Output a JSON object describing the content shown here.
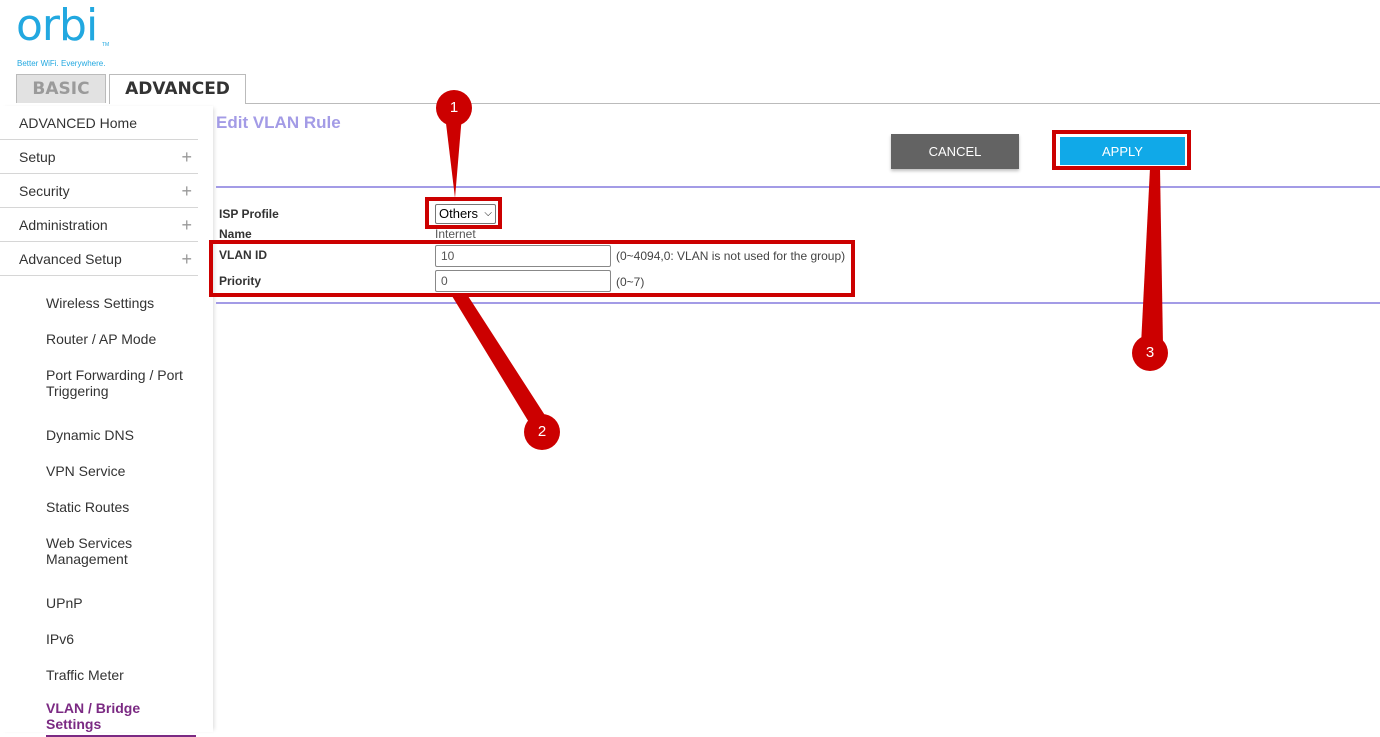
{
  "brand": {
    "logo": "orbi",
    "tm": "TM",
    "tagline": "Better WiFi. Everywhere."
  },
  "tabs": [
    {
      "label": "BASIC"
    },
    {
      "label": "ADVANCED"
    }
  ],
  "sidebar": {
    "top_items": [
      {
        "label": "ADVANCED Home"
      },
      {
        "label": "Setup",
        "icon": "plus-icon",
        "expand": "+"
      },
      {
        "label": "Security",
        "icon": "plus-icon",
        "expand": "+"
      },
      {
        "label": "Administration",
        "icon": "plus-icon",
        "expand": "+"
      },
      {
        "label": "Advanced Setup",
        "icon": "plus-icon",
        "expand": "+"
      }
    ],
    "sub_items": [
      {
        "label": "Wireless Settings"
      },
      {
        "label": "Router / AP Mode"
      },
      {
        "label": "Port Forwarding / Port Triggering"
      },
      {
        "label": "Dynamic DNS"
      },
      {
        "label": "VPN Service"
      },
      {
        "label": "Static Routes"
      },
      {
        "label": "Web Services Management"
      },
      {
        "label": "UPnP"
      },
      {
        "label": "IPv6"
      },
      {
        "label": "Traffic Meter"
      },
      {
        "label": "VLAN / Bridge Settings",
        "active": true
      }
    ]
  },
  "main": {
    "title": "Edit VLAN Rule",
    "cancel_label": "CANCEL",
    "apply_label": "APPLY",
    "form": {
      "isp_profile_label": "ISP Profile",
      "isp_profile_value": "Others",
      "name_label": "Name",
      "name_value": "Internet",
      "vlan_id_label": "VLAN ID",
      "vlan_id_value": "10",
      "vlan_id_hint": "(0~4094,0: VLAN is not used for the group)",
      "priority_label": "Priority",
      "priority_value": "0",
      "priority_hint": "(0~7)"
    }
  },
  "annotations": {
    "badges": [
      "1",
      "2",
      "3"
    ],
    "color": "#cc0000"
  },
  "colors": {
    "brand": "#22a8e0",
    "accent": "#a39be6",
    "apply": "#10a9e8",
    "active_nav": "#7b2a83"
  }
}
